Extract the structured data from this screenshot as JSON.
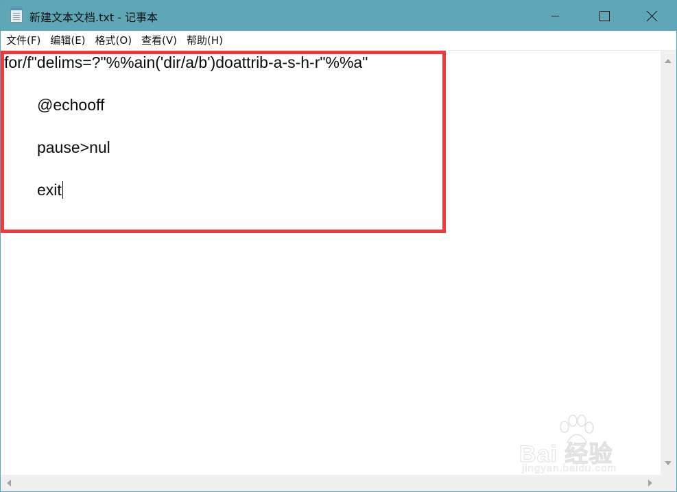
{
  "window": {
    "title": "新建文本文档.txt - 记事本",
    "app_icon": "notepad-icon"
  },
  "controls": {
    "minimize_icon": "minimize-icon",
    "maximize_icon": "maximize-icon",
    "close_icon": "close-icon"
  },
  "menu": {
    "items": [
      {
        "label": "文件(F)"
      },
      {
        "label": "编辑(E)"
      },
      {
        "label": "格式(O)"
      },
      {
        "label": "查看(V)"
      },
      {
        "label": "帮助(H)"
      }
    ]
  },
  "document": {
    "lines": [
      "for/f\"delims=?\"%%ain('dir/a/b')doattrib-a-s-h-r\"%%a\"",
      "@echooff",
      "pause>nul",
      "exit"
    ]
  },
  "annotation": {
    "highlight_color": "#f0393a"
  },
  "watermark": {
    "logo_text": "Bai 经验",
    "url": "jingyan.baidu.com"
  },
  "colors": {
    "titlebar": "#5ea7b7",
    "scrollbar": "#f0f0f0"
  }
}
